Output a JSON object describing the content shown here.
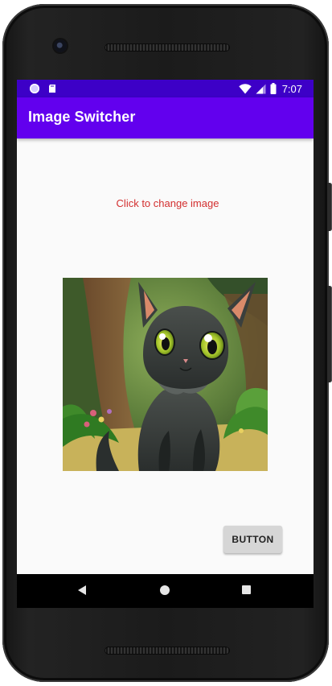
{
  "status_bar": {
    "time": "7:07",
    "icons": [
      "notification-circle-icon",
      "sd-card-icon",
      "wifi-icon",
      "cell-signal-icon",
      "battery-icon"
    ],
    "color": "#3d00c7"
  },
  "app_bar": {
    "title": "Image Switcher",
    "color": "#6200ee"
  },
  "main": {
    "hint": "Click to change image",
    "hint_color": "#d32f2f",
    "image": "black-kitten-in-forest-image",
    "button_label": "BUTTON"
  },
  "nav_bar": {
    "icons": [
      "back-icon",
      "home-icon",
      "recents-icon"
    ]
  }
}
